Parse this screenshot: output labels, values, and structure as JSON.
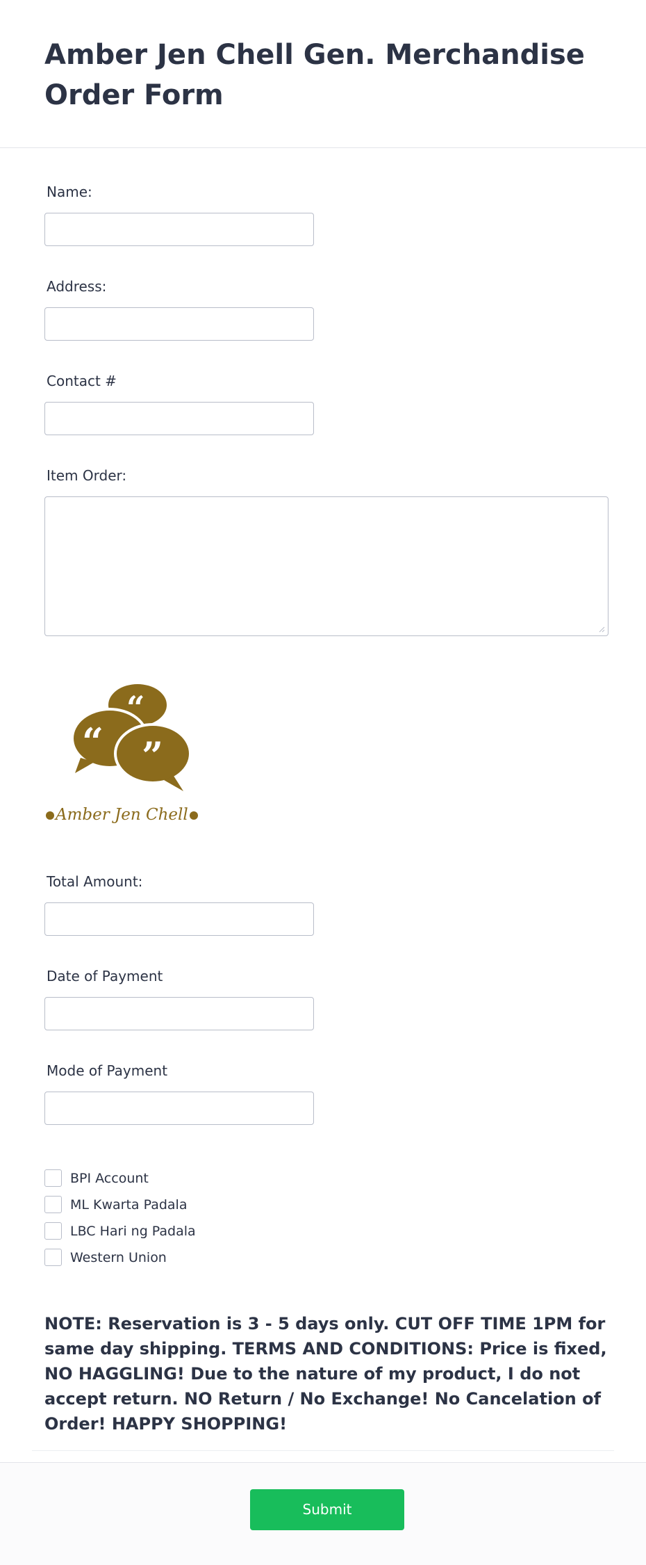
{
  "form": {
    "title": "Amber Jen Chell Gen. Merchandise Order Form"
  },
  "fields": {
    "name": {
      "label": "Name:",
      "value": ""
    },
    "address": {
      "label": "Address:",
      "value": ""
    },
    "contact": {
      "label": "Contact #",
      "value": ""
    },
    "item_order": {
      "label": "Item Order:",
      "value": ""
    },
    "total_amount": {
      "label": "Total Amount:",
      "value": ""
    },
    "date_of_payment": {
      "label": "Date of Payment",
      "value": ""
    },
    "mode_of_payment": {
      "label": "Mode of Payment",
      "value": ""
    }
  },
  "logo": {
    "icon": "speech-bubbles-quote-icon",
    "text": "Amber Jen Chell",
    "color": "#8b6b1c"
  },
  "payment_options": [
    {
      "label": "BPI Account",
      "checked": false
    },
    {
      "label": "ML Kwarta Padala",
      "checked": false
    },
    {
      "label": "LBC Hari ng Padala",
      "checked": false
    },
    {
      "label": "Western Union",
      "checked": false
    }
  ],
  "note": "NOTE: Reservation is 3 - 5 days only. CUT OFF TIME 1PM for same day shipping. TERMS AND CONDITIONS: Price is fixed, NO HAGGLING! Due to the nature of my product, I do not accept return. NO Return / No Exchange! No Cancelation of Order! HAPPY SHOPPING!",
  "submit": {
    "label": "Submit",
    "color": "#18bd5b"
  }
}
